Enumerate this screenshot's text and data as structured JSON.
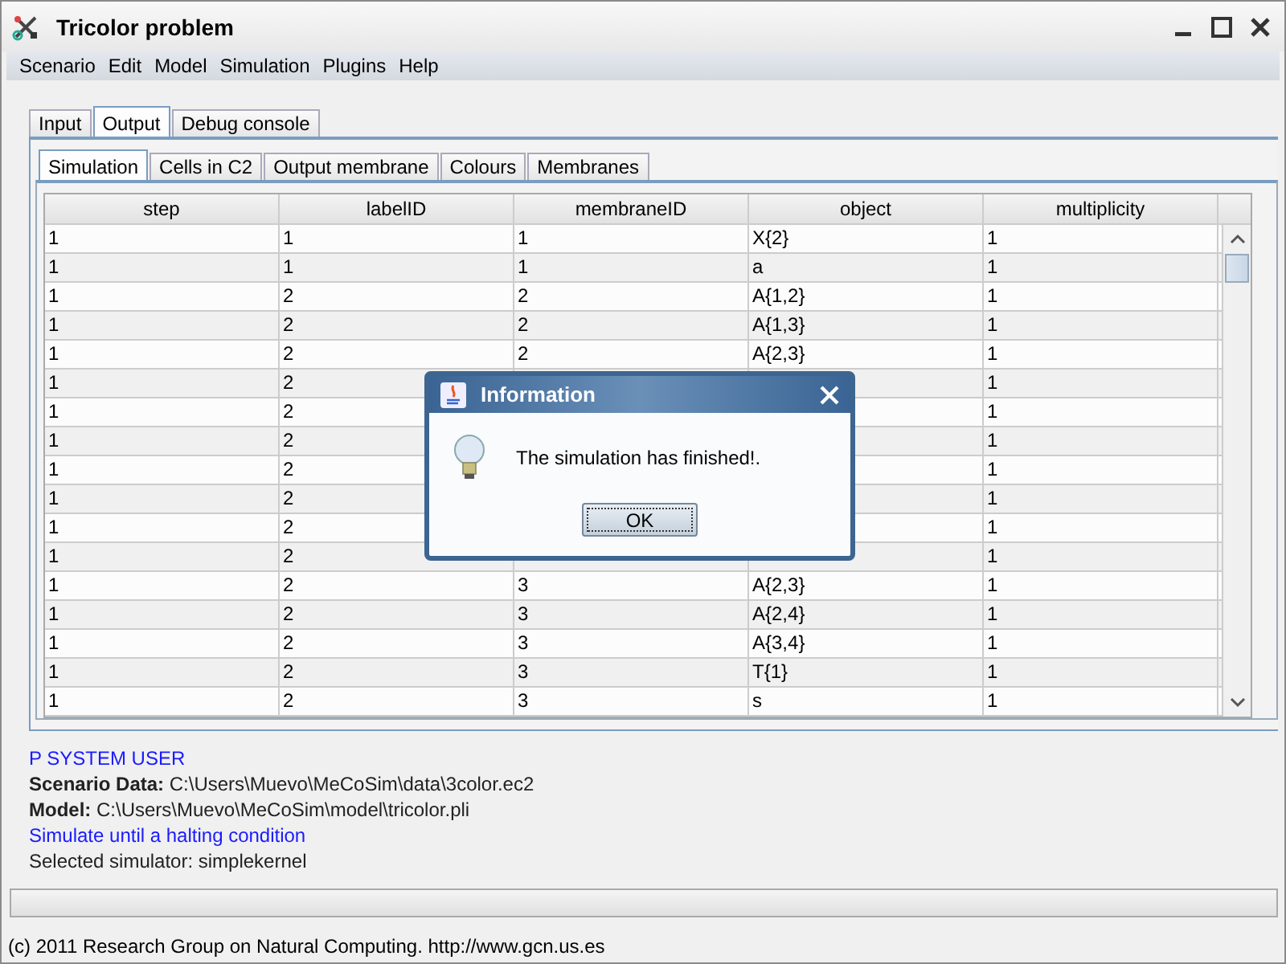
{
  "window": {
    "title": "Tricolor problem"
  },
  "menu": [
    "Scenario",
    "Edit",
    "Model",
    "Simulation",
    "Plugins",
    "Help"
  ],
  "tabs": [
    {
      "label": "Input",
      "selected": false
    },
    {
      "label": "Output",
      "selected": true
    },
    {
      "label": "Debug console",
      "selected": false
    }
  ],
  "subtabs": [
    {
      "label": "Simulation",
      "selected": true
    },
    {
      "label": "Cells in C2",
      "selected": false
    },
    {
      "label": "Output membrane",
      "selected": false
    },
    {
      "label": "Colours",
      "selected": false
    },
    {
      "label": "Membranes",
      "selected": false
    }
  ],
  "table": {
    "columns": [
      "step",
      "labelID",
      "membraneID",
      "object",
      "multiplicity"
    ],
    "rows": [
      [
        "1",
        "1",
        "1",
        "X{2}",
        "1"
      ],
      [
        "1",
        "1",
        "1",
        "a",
        "1"
      ],
      [
        "1",
        "2",
        "2",
        "A{1,2}",
        "1"
      ],
      [
        "1",
        "2",
        "2",
        "A{1,3}",
        "1"
      ],
      [
        "1",
        "2",
        "2",
        "A{2,3}",
        "1"
      ],
      [
        "1",
        "2",
        null,
        null,
        "1"
      ],
      [
        "1",
        "2",
        null,
        null,
        "1"
      ],
      [
        "1",
        "2",
        null,
        null,
        "1"
      ],
      [
        "1",
        "2",
        null,
        null,
        "1"
      ],
      [
        "1",
        "2",
        null,
        null,
        "1"
      ],
      [
        "1",
        "2",
        null,
        null,
        "1"
      ],
      [
        "1",
        "2",
        null,
        null,
        "1"
      ],
      [
        "1",
        "2",
        "3",
        "A{2,3}",
        "1"
      ],
      [
        "1",
        "2",
        "3",
        "A{2,4}",
        "1"
      ],
      [
        "1",
        "2",
        "3",
        "A{3,4}",
        "1"
      ],
      [
        "1",
        "2",
        "3",
        "T{1}",
        "1"
      ],
      [
        "1",
        "2",
        "3",
        "s",
        "1"
      ]
    ]
  },
  "dialog": {
    "title": "Information",
    "message": "The simulation has finished!.",
    "button": "OK"
  },
  "info_lines": [
    {
      "kind": "notice",
      "text": "P SYSTEM USER"
    },
    {
      "kind": "detail",
      "text": "**Scenario Data:** C:\\Users\\Muevo\\MeCoSim\\data\\3color.ec2"
    },
    {
      "kind": "detail",
      "text": "**Model:** C:\\Users\\Muevo\\MeCoSim\\model\\tricolor.pli"
    },
    {
      "kind": "notice",
      "text": "Simulate until a halting condition"
    },
    {
      "kind": "detail",
      "text": "Selected simulator: simplekernel"
    }
  ],
  "progress": {
    "level": 0
  },
  "status_bar": "(c) 2011 Research Group on Natural Computing. http://www.gcn.us.es"
}
